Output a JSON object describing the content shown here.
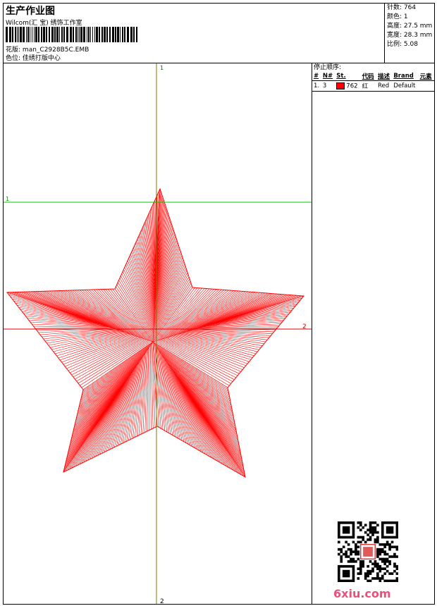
{
  "header": {
    "title": "生产作业图",
    "studio": "Wilcom(汇 宝) 绣饰工作室",
    "pattern_label": "花版:",
    "pattern_value": "man_C2928B5C.EMB",
    "colorpos_label": "色位:",
    "colorpos_value": "佳绣打版中心"
  },
  "stats": {
    "stitches": "针数: 764",
    "colors": "颜色: 1",
    "height": "高度: 27.5 mm",
    "width": "宽度: 28.3 mm",
    "ratio": "比例: 5.08"
  },
  "guides": {
    "top_marker": "1",
    "bottom_marker": "2",
    "left_marker": "1",
    "right_marker": "2",
    "vertical_color": "#7a7a00",
    "horizontal_top_color": "#00cc00",
    "horizontal_mid_color": "#e00000"
  },
  "design": {
    "stitch_color": "#ff0000"
  },
  "stop_sequence": {
    "title": "停止顺序:",
    "columns": [
      "#",
      "N#",
      "St.",
      "代码",
      "描述",
      "Brand",
      "元素"
    ],
    "rows": [
      {
        "index": "1.",
        "needle": "3",
        "swatch": "#ff0000",
        "stitches": "762",
        "code": "红",
        "description": "Red",
        "brand": "Default",
        "element": ""
      }
    ]
  },
  "watermark": {
    "site": "6xiu.com"
  }
}
